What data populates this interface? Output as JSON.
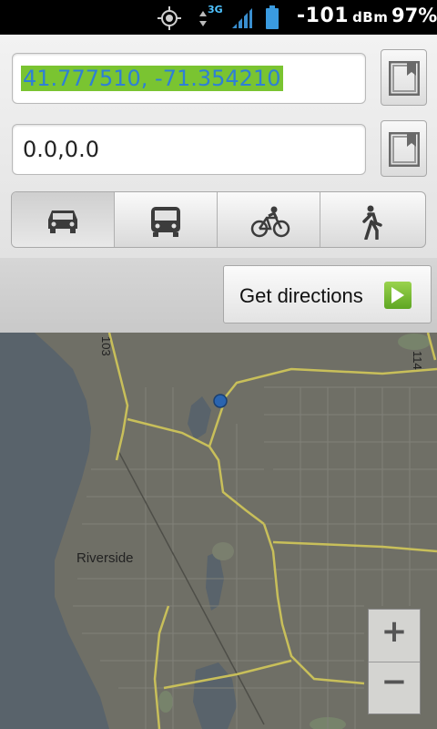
{
  "status_bar": {
    "network_type": "3G",
    "signal_value": "-101",
    "signal_unit": "dBm",
    "battery_percent": "97%"
  },
  "directions": {
    "from_value": "41.777510, -71.354210",
    "to_value": "0.0,0.0",
    "travel_modes": [
      "car-icon",
      "bus-icon",
      "bicycle-icon",
      "walk-icon"
    ],
    "selected_mode": "car",
    "get_directions_label": "Get directions"
  },
  "map": {
    "place_label": "Riverside",
    "route_labels": [
      "103",
      "114"
    ],
    "zoom_in_label": "+",
    "zoom_out_label": "−"
  },
  "colors": {
    "selection_highlight": "#7ac431",
    "selection_text": "#2e7fd6",
    "go_arrow": "#6bb52a",
    "location_dot": "#2a64b0"
  }
}
